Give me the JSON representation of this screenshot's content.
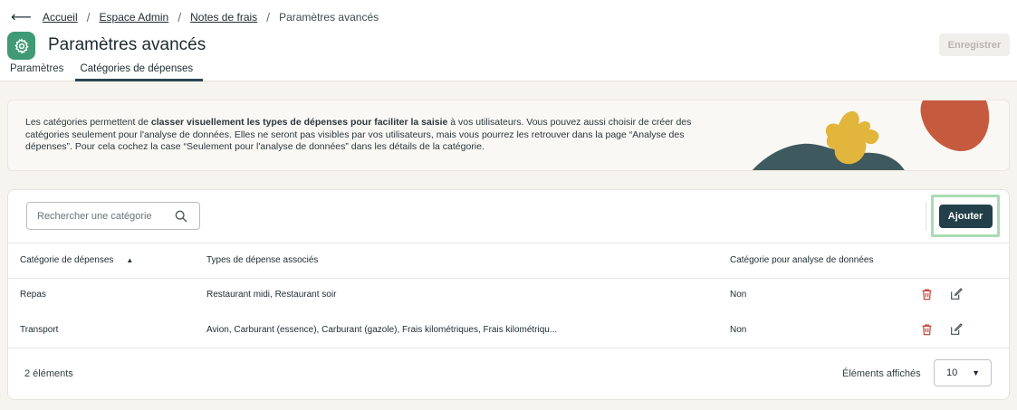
{
  "breadcrumb": {
    "items": [
      "Accueil",
      "Espace Admin",
      "Notes de frais"
    ],
    "current": "Paramètres avancés"
  },
  "header": {
    "title": "Paramètres avancés",
    "save_label": "Enregistrer",
    "icon": "gear-icon"
  },
  "tabs": [
    {
      "label": "Paramètres",
      "active": false
    },
    {
      "label": "Catégories de dépenses",
      "active": true
    }
  ],
  "info": {
    "part1": "Les catégories permettent de ",
    "bold": "classer visuellement les types de dépenses pour faciliter la saisie",
    "part2": " à vos utilisateurs. Vous pouvez aussi choisir de créer des catégories seulement pour l'analyse de données. Elles ne seront pas visibles par vos utilisateurs, mais vous pourrez les retrouver dans la page “Analyse des dépenses”. Pour cela cochez la case “Seulement pour l'analyse de données” dans les détails de la catégorie."
  },
  "search": {
    "placeholder": "Rechercher une catégorie"
  },
  "add_label": "Ajouter",
  "table": {
    "columns": [
      "Catégorie de dépenses",
      "Types de dépense associés",
      "Catégorie pour analyse de données"
    ],
    "rows": [
      {
        "category": "Repas",
        "types": "Restaurant midi, Restaurant soir",
        "analysis": "Non"
      },
      {
        "category": "Transport",
        "types": "Avion, Carburant (essence), Carburant (gazole), Frais kilométriques, Frais kilométriqu...",
        "analysis": "Non"
      }
    ]
  },
  "footer": {
    "count": "2 éléments",
    "page_size_label": "Éléments affichés",
    "page_size_value": "10"
  },
  "colors": {
    "accent": "#23404a",
    "icon_bg": "#3f9a75",
    "highlight": "#a8dcb3",
    "delete": "#c0392b",
    "deco_yellow": "#e2b53c",
    "deco_red": "#c65a3e",
    "deco_slate": "#3f5a5e"
  }
}
